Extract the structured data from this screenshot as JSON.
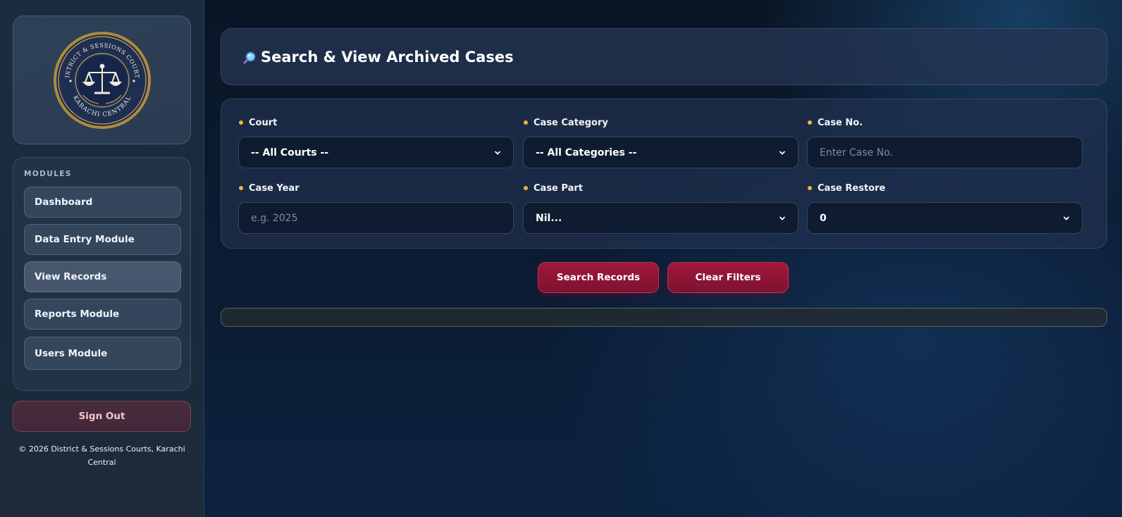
{
  "logo": {
    "top_text": "DISTRICT & SESSIONS COURTS",
    "bottom_text": "KARACHI CENTRAL",
    "icon": "scales-of-justice-icon"
  },
  "sidebar": {
    "modules_title": "MODULES",
    "items": [
      {
        "label": "Dashboard"
      },
      {
        "label": "Data Entry Module"
      },
      {
        "label": "View Records"
      },
      {
        "label": "Reports Module"
      },
      {
        "label": "Users Module"
      }
    ],
    "active_item": "View Records",
    "sign_out": "Sign Out",
    "footer": "© 2026 District & Sessions Courts, Karachi Central"
  },
  "header": {
    "icon": "magnifier-icon",
    "title": "Search & View Archived Cases"
  },
  "filters": {
    "court": {
      "label": "Court",
      "value": "-- All Courts --"
    },
    "case_category": {
      "label": "Case Category",
      "value": "-- All Categories --"
    },
    "case_no": {
      "label": "Case No.",
      "placeholder": "Enter Case No."
    },
    "case_year": {
      "label": "Case Year",
      "placeholder": "e.g. 2025"
    },
    "case_part": {
      "label": "Case Part",
      "value": "Nil..."
    },
    "case_restore": {
      "label": "Case Restore",
      "value": "0"
    }
  },
  "actions": {
    "search": "Search Records",
    "clear": "Clear Filters"
  },
  "colors": {
    "accent_dot": "#f0b43c",
    "button": "#8f1535",
    "sign_out_text": "#f4c4cc"
  }
}
